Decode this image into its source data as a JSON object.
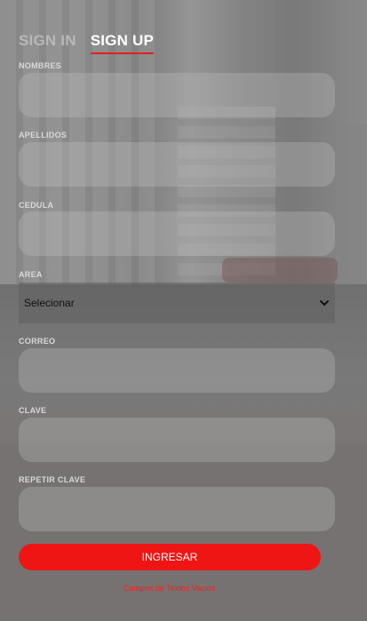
{
  "tabs": {
    "signin_label": "SIGN IN",
    "signup_label": "SIGN UP"
  },
  "fields": {
    "nombres": {
      "label": "NOMBRES",
      "value": ""
    },
    "apellidos": {
      "label": "APELLIDOS",
      "value": ""
    },
    "cedula": {
      "label": "CEDULA",
      "value": ""
    },
    "area": {
      "label": "AREA",
      "selected": "Selecionar"
    },
    "correo": {
      "label": "CORREO",
      "value": ""
    },
    "clave": {
      "label": "CLAVE",
      "value": ""
    },
    "repetir_clave": {
      "label": "REPETIR CLAVE",
      "value": ""
    }
  },
  "submit_label": "INGRESAR",
  "error_text": "Campos de Textos Vacios",
  "colors": {
    "accent": "#f01515",
    "error": "#ff1a1a"
  },
  "icons": {
    "select_chevron": "chevron-down-icon"
  }
}
